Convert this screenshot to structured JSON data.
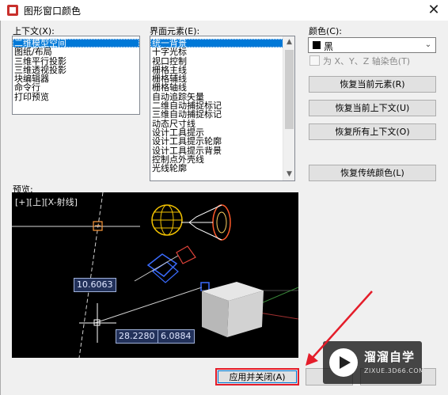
{
  "window": {
    "title": "图形窗口颜色",
    "close_glyph": "✕"
  },
  "context": {
    "label": "上下文(X):",
    "items": [
      {
        "label": "二维模型空间",
        "selected": true
      },
      {
        "label": "图纸/布局",
        "selected": false
      },
      {
        "label": "三维平行投影",
        "selected": false
      },
      {
        "label": "三维透视投影",
        "selected": false
      },
      {
        "label": "块编辑器",
        "selected": false
      },
      {
        "label": "命令行",
        "selected": false
      },
      {
        "label": "打印预览",
        "selected": false
      }
    ]
  },
  "interface_elements": {
    "label": "界面元素(E):",
    "items": [
      {
        "label": "统一背景",
        "selected": true
      },
      {
        "label": "十字光标",
        "selected": false
      },
      {
        "label": "视口控制",
        "selected": false
      },
      {
        "label": "栅格主线",
        "selected": false
      },
      {
        "label": "栅格辅线",
        "selected": false
      },
      {
        "label": "栅格轴线",
        "selected": false
      },
      {
        "label": "自动追踪矢量",
        "selected": false
      },
      {
        "label": "二维自动捕捉标记",
        "selected": false
      },
      {
        "label": "三维自动捕捉标记",
        "selected": false
      },
      {
        "label": "动态尺寸线",
        "selected": false
      },
      {
        "label": "设计工具提示",
        "selected": false
      },
      {
        "label": "设计工具提示轮廓",
        "selected": false
      },
      {
        "label": "设计工具提示背景",
        "selected": false
      },
      {
        "label": "控制点外壳线",
        "selected": false
      },
      {
        "label": "光线轮廓",
        "selected": false
      }
    ]
  },
  "color": {
    "label": "颜色(C):",
    "value": "黑",
    "swatch": "#000000",
    "tint_label": "为 X、Y、Z 轴染色(T)"
  },
  "buttons": {
    "restore_element": "恢复当前元素(R)",
    "restore_context": "恢复当前上下文(U)",
    "restore_all": "恢复所有上下文(O)",
    "restore_classic": "恢复传统颜色(L)"
  },
  "preview": {
    "label": "预览:",
    "viewport_label": "[+][上][X-射线]",
    "dim_1": "10.6063",
    "dim_2": "28.2280",
    "dim_3": "6.0884"
  },
  "footer": {
    "apply_close": "应用并关闭(A)"
  },
  "watermark": {
    "title": "溜溜自学",
    "subtitle": "ZIXUE.3D66.COM"
  },
  "colors": {
    "selection": "#0078d7",
    "highlight_box": "#e41d2a",
    "annotation_arrow": "#e41d2a"
  },
  "icons": {
    "app": "palette-icon",
    "close": "close-icon",
    "dropdown": "chevron-down-icon",
    "scroll_up": "scroll-up-icon",
    "scroll_down": "scroll-down-icon"
  }
}
